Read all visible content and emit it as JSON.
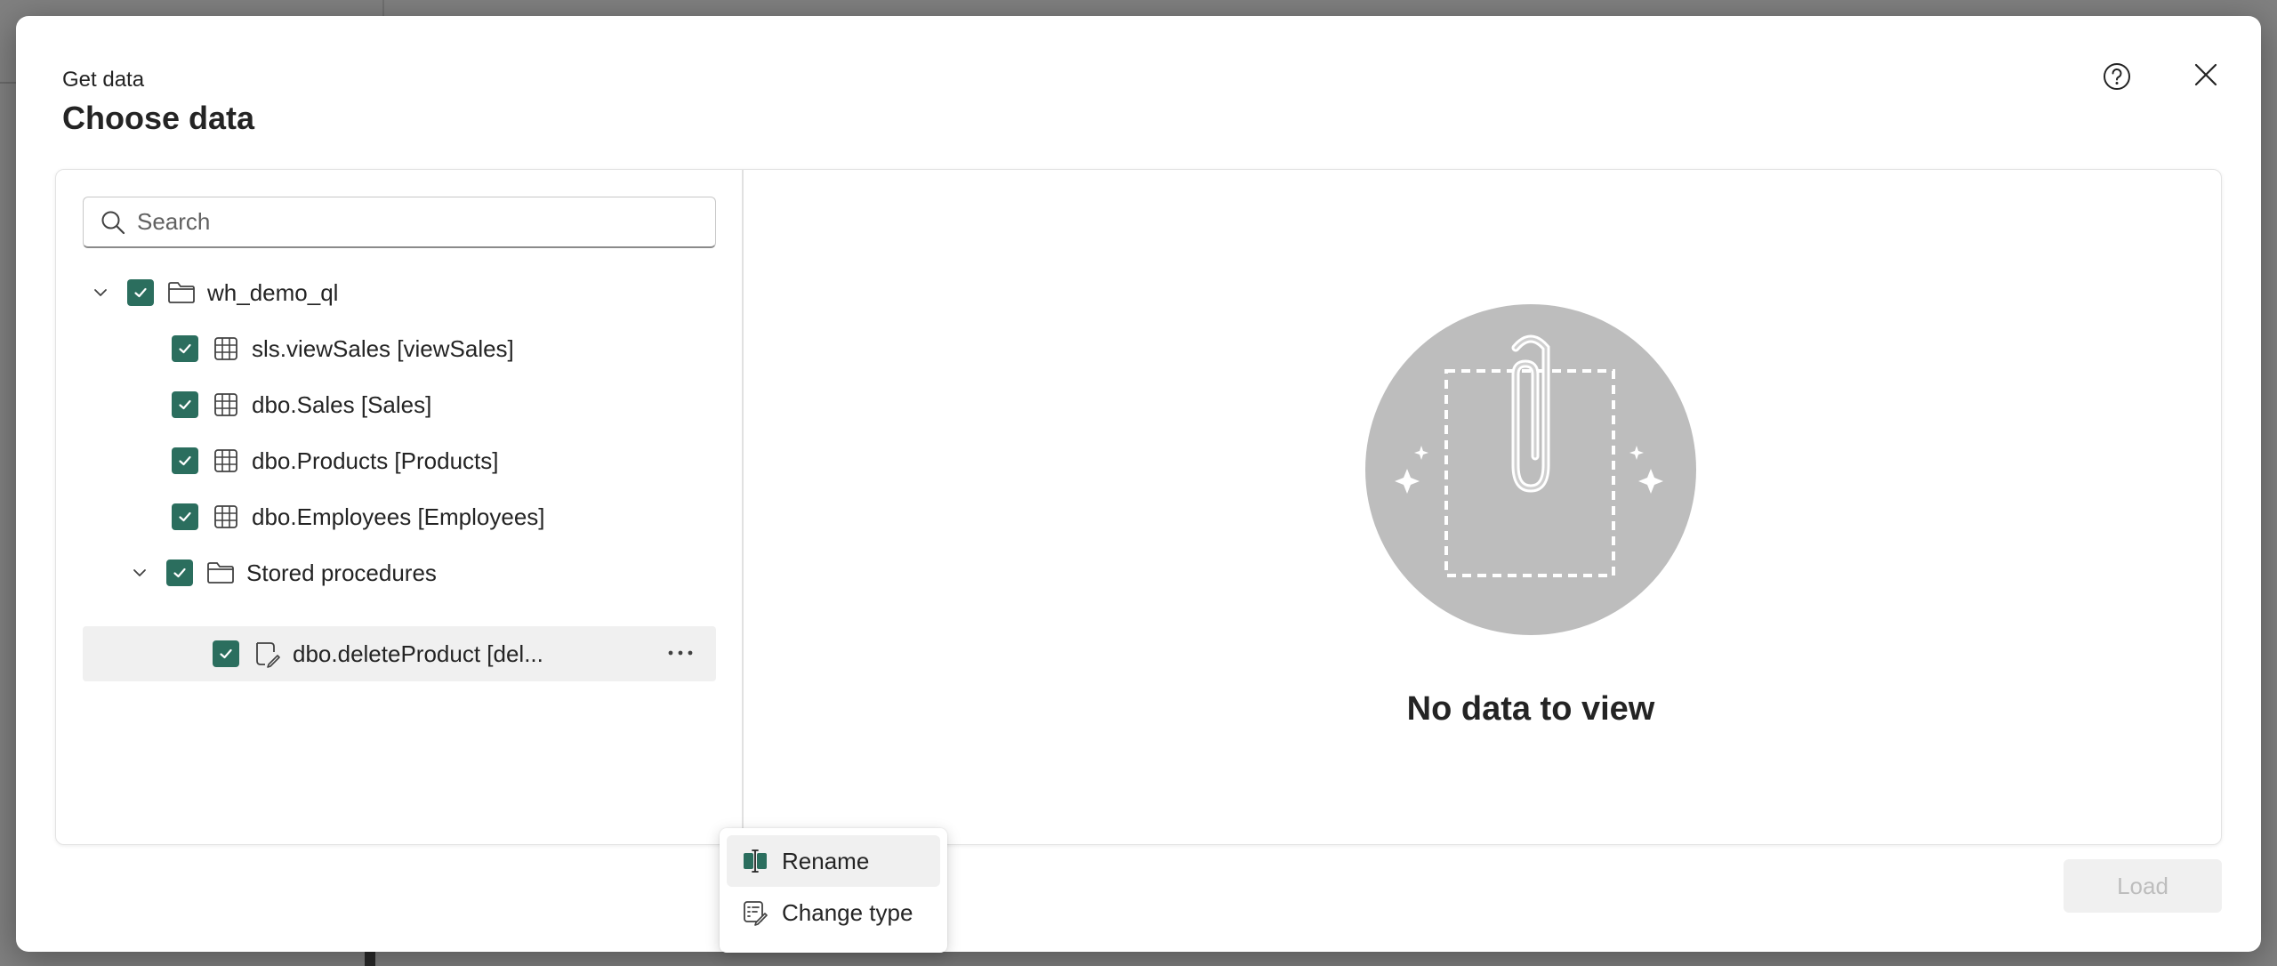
{
  "dialog": {
    "subtitle": "Get data",
    "title": "Choose data"
  },
  "search": {
    "placeholder": "Search",
    "value": ""
  },
  "tree": {
    "root": {
      "label": "wh_demo_ql",
      "checked": true,
      "expanded": true
    },
    "items": [
      {
        "label": "sls.viewSales [viewSales]",
        "icon": "table-icon",
        "checked": true
      },
      {
        "label": "dbo.Sales [Sales]",
        "icon": "table-icon",
        "checked": true
      },
      {
        "label": "dbo.Products [Products]",
        "icon": "table-icon",
        "checked": true
      },
      {
        "label": "dbo.Employees [Employees]",
        "icon": "table-icon",
        "checked": true
      }
    ],
    "stored_procedures": {
      "label": "Stored procedures",
      "checked": true,
      "expanded": true
    },
    "procedure": {
      "label": "dbo.deleteProduct [del...",
      "icon": "stored-procedure-icon",
      "checked": true
    }
  },
  "context_menu": {
    "items": [
      {
        "label": "Rename",
        "icon": "rename-icon"
      },
      {
        "label": "Change type",
        "icon": "change-type-icon"
      }
    ]
  },
  "preview": {
    "empty_message": "No data to view"
  },
  "footer": {
    "load_label": "Load"
  },
  "colors": {
    "checkbox": "#2b6e5e",
    "illustration_circle": "#bdbdbd",
    "rename_accent": "#2b6e5e"
  }
}
